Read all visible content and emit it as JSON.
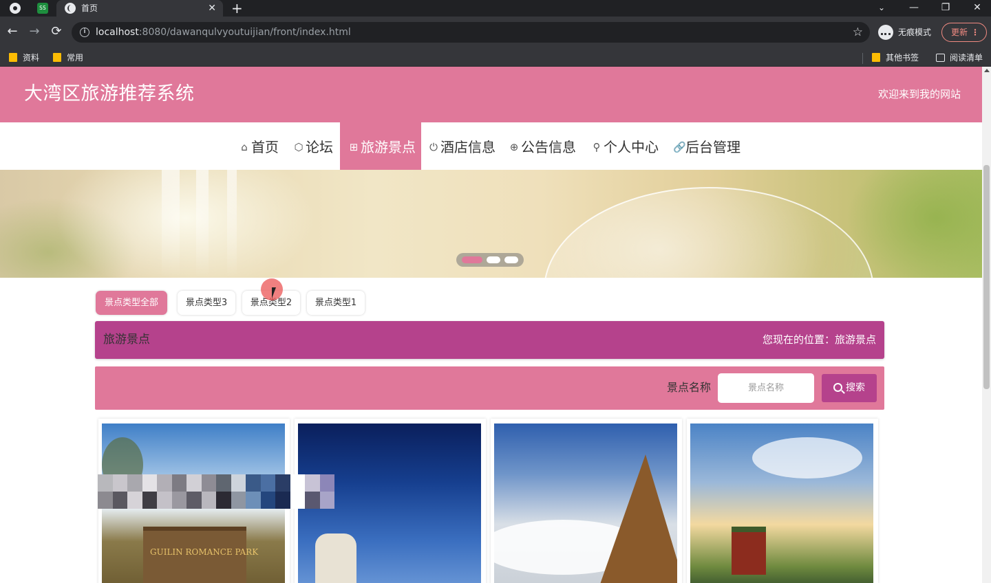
{
  "browser": {
    "pinned_tab_label": "SS",
    "tab_title": "首页",
    "tab_close": "✕",
    "new_tab": "+",
    "win_min": "—",
    "win_max": "❐",
    "win_close": "✕",
    "back": "←",
    "forward": "→",
    "reload": "⟳",
    "url_host": "localhost",
    "url_rest": ":8080/dawanqulvyoutuijian/front/index.html",
    "star": "☆",
    "incognito_label": "无痕模式",
    "update_label": "更新",
    "update_menu": "⋮",
    "bookmarks": [
      "资料",
      "常用"
    ],
    "other_bookmarks": "其他书签",
    "reading_list": "阅读清单"
  },
  "site": {
    "title": "大湾区旅游推荐系统",
    "welcome": "欢迎来到我的网站"
  },
  "nav": [
    {
      "icon": "⌂",
      "label": "首页",
      "active": false
    },
    {
      "icon": "⬡",
      "label": "论坛",
      "active": false
    },
    {
      "icon": "⊞",
      "label": "旅游景点",
      "active": true
    },
    {
      "icon": "⏻",
      "label": "酒店信息",
      "active": false
    },
    {
      "icon": "⊕",
      "label": "公告信息",
      "active": false
    },
    {
      "icon": "⚲",
      "label": "个人中心",
      "active": false
    },
    {
      "icon": "🔗",
      "label": "后台管理",
      "active": false
    }
  ],
  "carousel": {
    "slides": 3,
    "active_index": 0
  },
  "types": [
    {
      "label": "景点类型全部",
      "active": true
    },
    {
      "label": "景点类型3",
      "active": false
    },
    {
      "label": "景点类型2",
      "active": false
    },
    {
      "label": "景点类型1",
      "active": false
    }
  ],
  "section": {
    "title": "旅游景点",
    "breadcrumb": "您现在的位置：旅游景点"
  },
  "search": {
    "label": "景点名称",
    "placeholder": "景点名称",
    "button": "搜索"
  },
  "cards": [
    {
      "image_text": "GUILIN ROMANCE PARK"
    },
    {
      "image_text": ""
    },
    {
      "image_text": ""
    },
    {
      "image_text": ""
    }
  ],
  "colors": {
    "primary": "#e0789a",
    "accent": "#b5428c"
  }
}
